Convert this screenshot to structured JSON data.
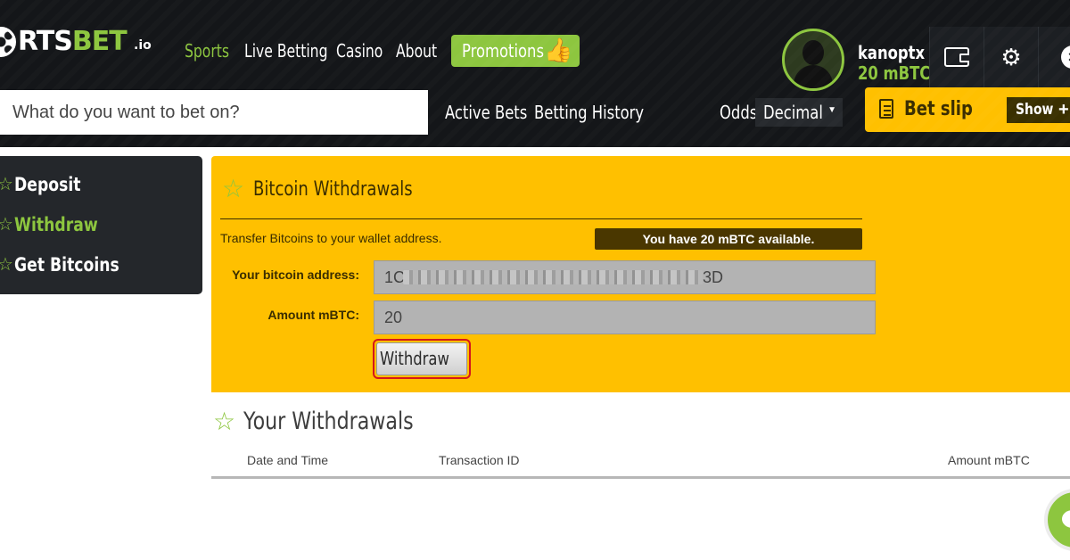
{
  "brand": {
    "logo_main": "RTS",
    "logo_accent": "BET",
    "logo_suffix": ".io"
  },
  "nav": {
    "sports": "Sports",
    "live_betting": "Live Betting",
    "casino": "Casino",
    "about": "About",
    "promotions": "Promotions"
  },
  "user": {
    "name": "kanoptx",
    "balance": "20 mBTC"
  },
  "search": {
    "placeholder": "What do you want to bet on?"
  },
  "subnav": {
    "active_bets": "Active Bets",
    "betting_history": "Betting History",
    "odds_label": "Odds",
    "odds_value": "Decimal"
  },
  "betslip": {
    "title": "Bet slip",
    "show_label": "Show",
    "plus": "+"
  },
  "sidebar": {
    "items": [
      {
        "label": "Deposit",
        "active": false
      },
      {
        "label": "Withdraw",
        "active": true
      },
      {
        "label": "Get Bitcoins",
        "active": false
      }
    ]
  },
  "panel": {
    "title": "Bitcoin Withdrawals",
    "transfer_text": "Transfer Bitcoins to your wallet address.",
    "available_text": "You have 20 mBTC available.",
    "address_label": "Your bitcoin address:",
    "address_start": "1C",
    "address_end": "3D",
    "amount_label": "Amount mBTC:",
    "amount_value": "20",
    "withdraw_button": "Withdraw"
  },
  "withdrawals": {
    "title": "Your Withdrawals",
    "columns": [
      "Date and Time",
      "Transaction ID",
      "Amount mBTC"
    ]
  },
  "colors": {
    "accent_green": "#8dc63f",
    "panel_yellow": "#ffc000",
    "header_dark": "#141619",
    "highlight_red": "#d4161c"
  }
}
